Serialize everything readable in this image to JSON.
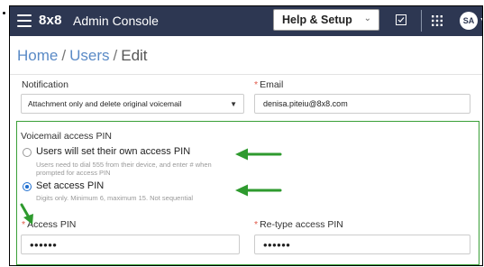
{
  "header": {
    "brand": "8x8",
    "title": "Admin Console",
    "help_menu": "Help & Setup",
    "avatar_initials": "SA",
    "bar_color": "#2d3752"
  },
  "breadcrumb": {
    "home": "Home",
    "separator": "/",
    "users": "Users",
    "current": "Edit"
  },
  "form": {
    "notification_label": "Notification",
    "notification_value": "Attachment only and delete original voicemail",
    "email_label": "Email",
    "email_value": "denisa.piteiu@8x8.com",
    "voicemail_section_title": "Voicemail access PIN",
    "option_own_pin": {
      "label": "Users will set their own access PIN",
      "help": "Users need to dial 555 from their device, and enter # when prompted for access PIN",
      "selected": false
    },
    "option_set_pin": {
      "label": "Set access PIN",
      "help": "Digits only. Minimum 6, maximum 15. Not sequential",
      "selected": true
    },
    "access_pin_label": "Access PIN",
    "access_pin_value": "••••••",
    "retype_pin_label": "Re-type access PIN",
    "retype_pin_value": "••••••",
    "required_marker": "*"
  },
  "annotations": {
    "highlight_color": "#3aa038",
    "arrow_color": "#2e9a2e"
  }
}
